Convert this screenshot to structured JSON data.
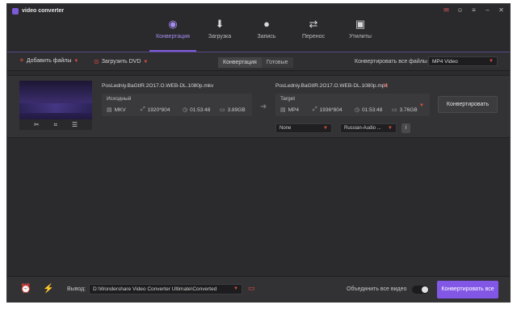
{
  "app": {
    "title": "video converter"
  },
  "window_controls": [
    "gift-icon",
    "account-icon",
    "menu-icon",
    "minimize-icon",
    "close-icon"
  ],
  "nav": {
    "tabs": [
      {
        "label": "Конвертация",
        "icon": "convert-icon",
        "active": true
      },
      {
        "label": "Загрузка",
        "icon": "download-icon",
        "active": false
      },
      {
        "label": "Запись",
        "icon": "burn-icon",
        "active": false
      },
      {
        "label": "Перенос",
        "icon": "transfer-icon",
        "active": false
      },
      {
        "label": "Утилиты",
        "icon": "toolbox-icon",
        "active": false
      }
    ]
  },
  "toolbar": {
    "add_files": "Добавить файлы",
    "load_dvd": "Загрузить DVD",
    "seg_converting": "Конвертация",
    "seg_done": "Готовые",
    "convert_all_to_label": "Конвертировать все файлы в",
    "format_value": "MP4 Video"
  },
  "file": {
    "source": {
      "name": "PosLedniy.BaGtIR.2O17.O.WEB-DL.1080p.mkv",
      "panel_label": "Исходный",
      "format": "MKV",
      "resolution": "1920*804",
      "duration": "01:53:48",
      "size": "3.89GB"
    },
    "target": {
      "name": "PosLedniy.BaGtIR.2O17.O.WEB-DL.1080p.mp4",
      "panel_label": "Target",
      "format": "MP4",
      "resolution": "1936*804",
      "duration": "01:53:48",
      "size": "3.76GB"
    },
    "convert_label": "Конвертировать",
    "subtitle_value": "None",
    "audio_value": "Russian-Audio ..."
  },
  "footer": {
    "output_label": "Вывод:",
    "output_path": "D:\\Wondershare Video Converter Ultimate\\Converted",
    "merge_label": "Объединить все видео",
    "merge_on": false,
    "convert_all_label": "Конвертировать все"
  },
  "colors": {
    "accent": "#8357e6",
    "icon_red": "#e0503f",
    "bg": "#2b2b2d"
  }
}
